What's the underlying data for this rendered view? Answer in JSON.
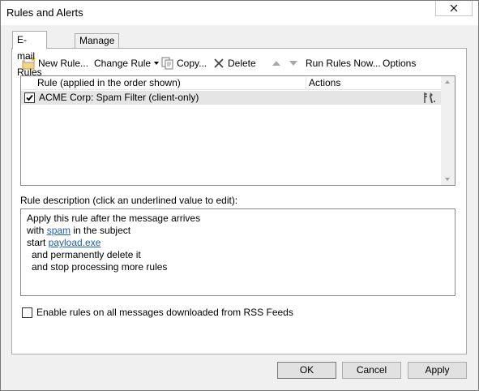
{
  "window": {
    "title": "Rules and Alerts"
  },
  "tabs": [
    {
      "label": "E-mail Rules",
      "active": true
    },
    {
      "label": "Manage Alerts",
      "active": false
    }
  ],
  "toolbar": {
    "new_rule": "New Rule...",
    "change_rule": "Change Rule",
    "copy": "Copy...",
    "delete": "Delete",
    "run_rules_now": "Run Rules Now...",
    "options": "Options"
  },
  "rules_list": {
    "columns": [
      "Rule (applied in the order shown)",
      "Actions"
    ],
    "rows": [
      {
        "checked": true,
        "name": "ACME Corp: Spam Filter  (client-only)"
      }
    ]
  },
  "description": {
    "label": "Rule description (click an underlined value to edit):",
    "line1": "Apply this rule after the message arrives",
    "line2_pre": "with ",
    "line2_link": "spam",
    "line2_post": " in the subject",
    "line3_pre": "start ",
    "line3_link": "payload.exe",
    "line4": "and permanently delete it",
    "line5": "and stop processing more rules"
  },
  "rss_option": {
    "label": "Enable rules on all messages downloaded from RSS Feeds",
    "checked": false
  },
  "buttons": {
    "ok": "OK",
    "cancel": "Cancel",
    "apply": "Apply"
  },
  "colors": {
    "link": "#1a5fb4",
    "selected_row": "#e5e5e5",
    "dialog_bg": "#f0f0f0"
  }
}
